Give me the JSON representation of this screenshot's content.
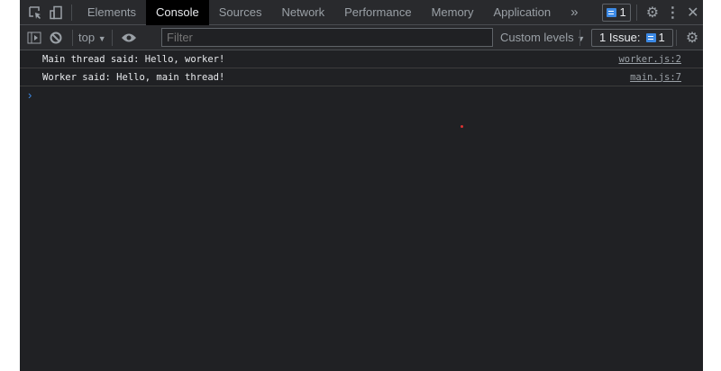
{
  "tabs": [
    "Elements",
    "Console",
    "Sources",
    "Network",
    "Performance",
    "Memory",
    "Application"
  ],
  "active_tab": "Console",
  "more_tabs": "»",
  "messages_badge_count": "1",
  "context": "top",
  "filter_placeholder": "Filter",
  "levels": "Custom levels",
  "issues_label": "1 Issue:",
  "issues_count": "1",
  "console": [
    {
      "text": "Main thread said: Hello, worker!",
      "source": "worker.js:2"
    },
    {
      "text": "Worker said: Hello, main thread!",
      "source": "main.js:7"
    }
  ],
  "prompt": "›",
  "colors": {
    "accent": "#3d8ae5",
    "background": "#202124"
  }
}
